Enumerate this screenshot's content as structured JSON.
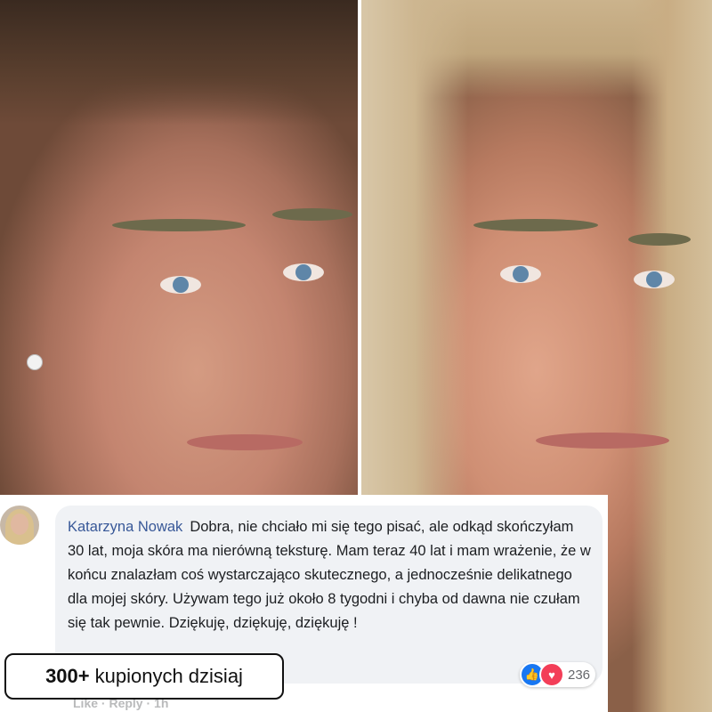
{
  "comment": {
    "author": "Katarzyna Nowak",
    "text": "Dobra, nie chciało mi się tego pisać, ale odkąd skończyłam 30 lat, moja skóra ma nierówną teksturę. Mam teraz 40 lat i mam wrażenie, że w końcu znalazłam coś wystarczająco skutecznego, a jednocześnie delikatnego dla mojej skóry. Używam tego już około 8 tygodni i chyba od dawna nie czułam się tak pewnie. Dziękuję, dziękuję, dziękuję !",
    "reaction_count": "236",
    "like_label": "Like",
    "reply_label": "Reply",
    "time_label": "1h",
    "separator": "·"
  },
  "badge": {
    "count": "300+",
    "text": "kupionych dzisiaj"
  },
  "icons": {
    "like": "thumbs-up-icon",
    "heart": "heart-icon"
  },
  "colors": {
    "author": "#385898",
    "like_blue": "#1877f2",
    "heart_red": "#f33e58",
    "bubble_bg": "#f0f2f5"
  }
}
